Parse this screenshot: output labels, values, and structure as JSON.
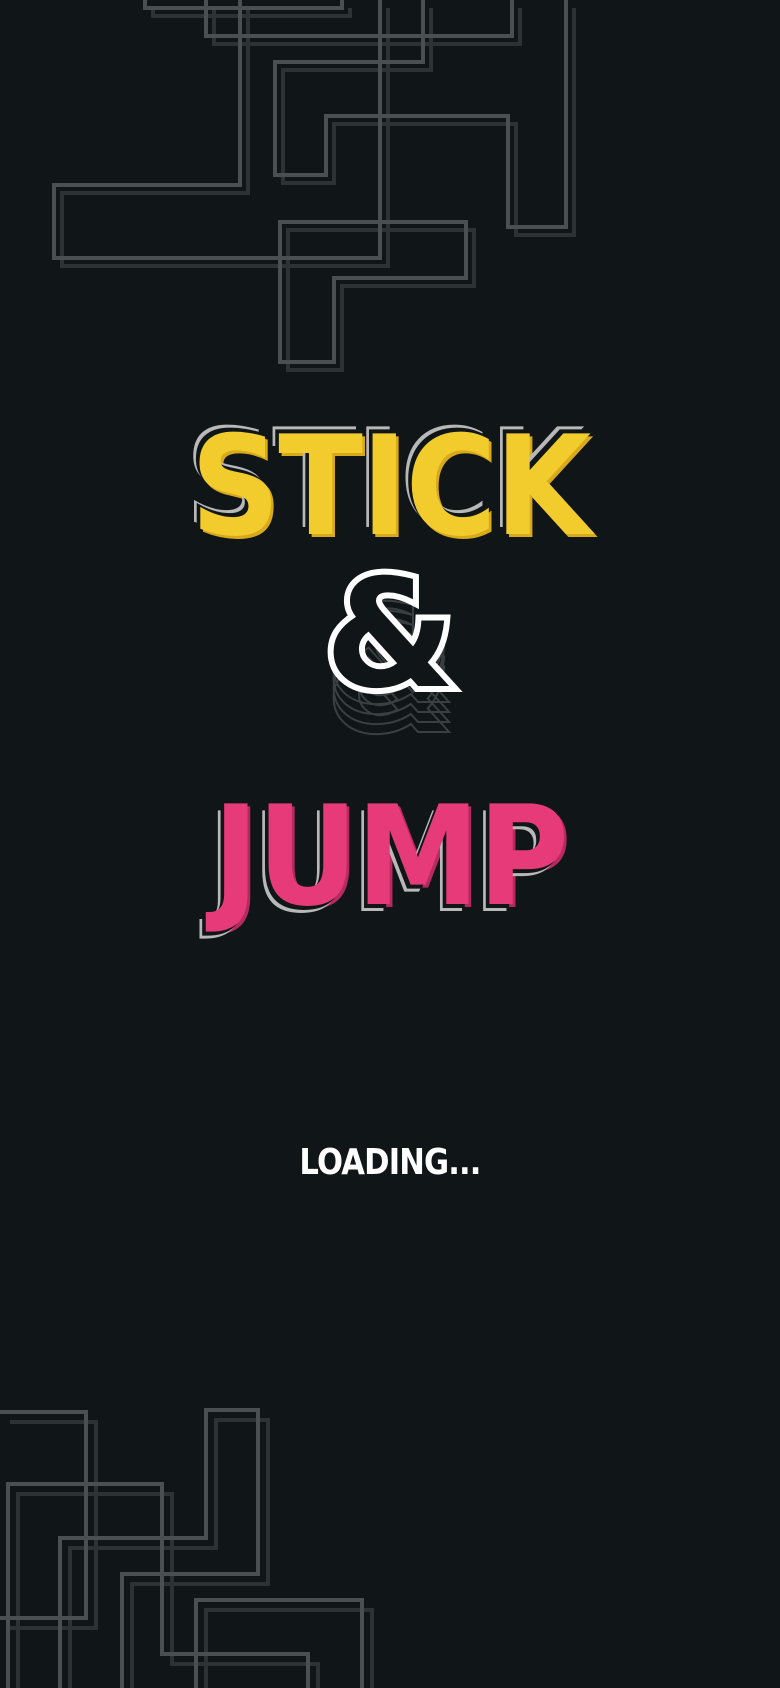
{
  "title": {
    "word1": "STICK",
    "ampersand": "&",
    "word2": "JUMP"
  },
  "status": {
    "loading_label": "LOADING..."
  },
  "colors": {
    "background": "#101618",
    "stick_yellow": "#f2cc2c",
    "jump_pink": "#e73a78",
    "ampersand_white": "#ffffff",
    "outline_grey": "#b8b8b8",
    "decor_lines": "#4a4f51"
  }
}
